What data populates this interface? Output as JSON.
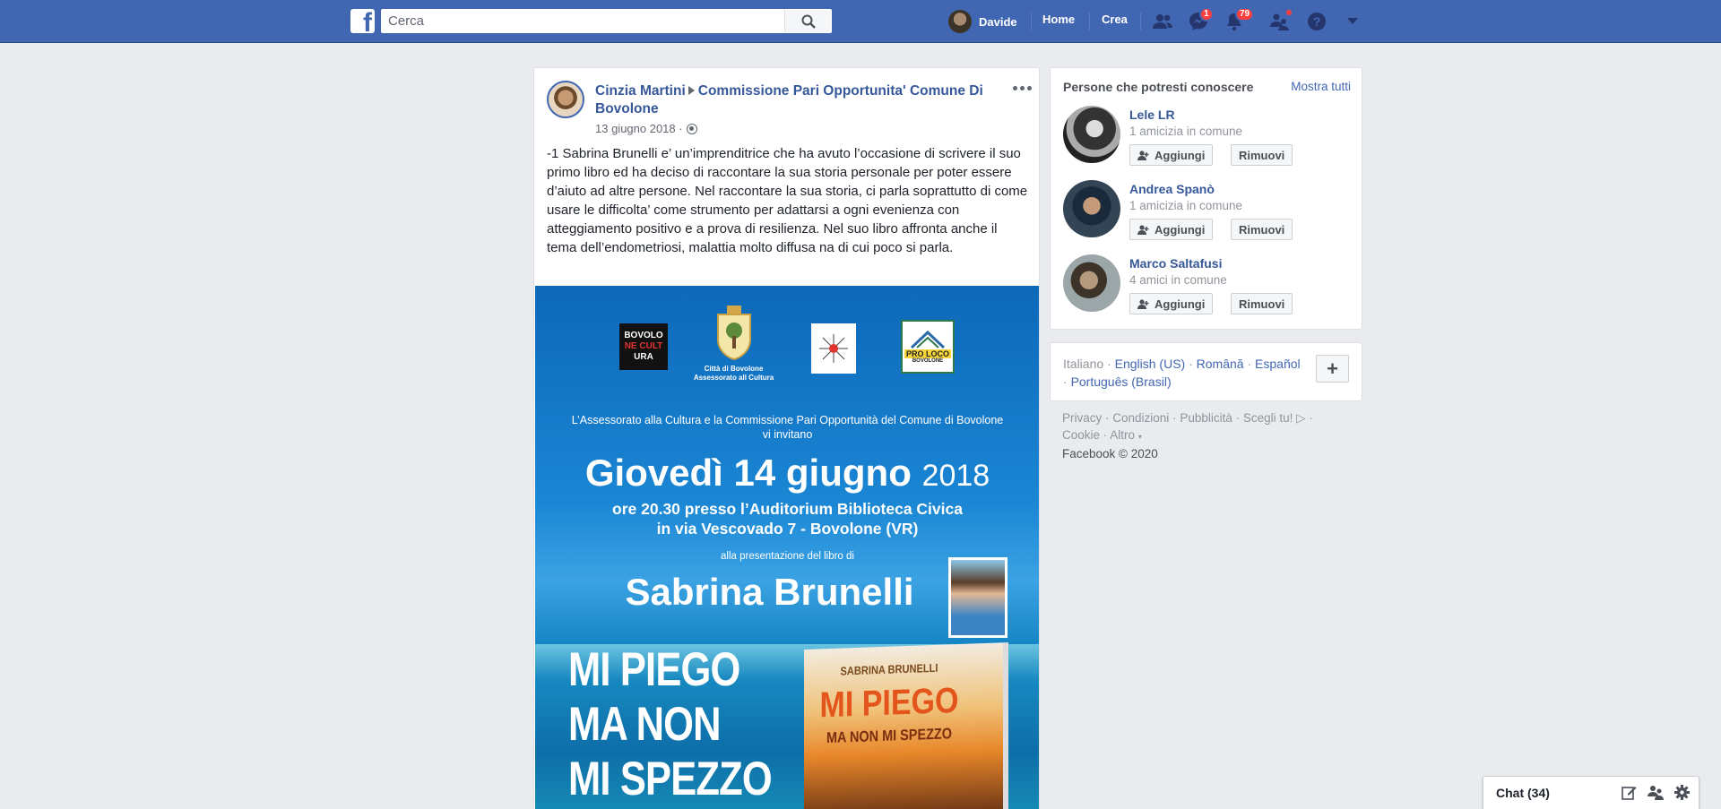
{
  "topbar": {
    "logo": "f",
    "search_placeholder": "Cerca",
    "user_name": "Davide",
    "home_label": "Home",
    "create_label": "Crea",
    "messenger_badge": "1",
    "notifications_badge": "79"
  },
  "post": {
    "author": "Cinzia Martini",
    "group": "Commissione Pari Opportunita' Comune Di Bovolone",
    "date": "13 giugno 2018 ·",
    "text": "-1 Sabrina Brunelli e’ un’imprenditrice che ha avuto l’occasione di scrivere il suo primo libro ed ha deciso di raccontare la sua storia personale per poter essere d’aiuto ad altre persone. Nel raccontare la sua storia, ci parla soprattutto di come usare le difficolta’ come strumento per adattarsi a ogni evenienza con atteggiamento positivo e a prova di resilienza. Nel suo libro affronta anche il tema dell’endometriosi, malattia molto diffusa na di cui poco si parla.",
    "poster": {
      "logo1_line1": "BOVOLO",
      "logo1_line2": "NE CULT",
      "logo1_line3": "URA",
      "logo2_caption1": "Città di Bovolone",
      "logo2_caption2": "Assessorato all Cultura",
      "logo4_text": "PRO LOCO",
      "logo4_sub": "BOVOLONE",
      "invite_line1": "L’Assessorato alla Cultura e la Commissione Pari Opportunità del Comune di Bovolone",
      "invite_line2": "vi invitano",
      "date_main": "Giovedì 14 giugno",
      "date_year": "2018",
      "venue_line1": "ore 20.30 presso l’Auditorium Biblioteca Civica",
      "venue_line2": "in via Vescovado 7 - Bovolone (VR)",
      "presentation": "alla presentazione del libro di",
      "author": "Sabrina Brunelli",
      "title_line1": "MI PIEGO",
      "title_line2": "MA NON",
      "title_line3": "MI SPEZZO",
      "book_author": "SABRINA BRUNELLI",
      "book_title": "MI PIEGO",
      "book_subtitle": "MA NON MI SPEZZO"
    }
  },
  "pymk": {
    "title": "Persone che potresti conoscere",
    "see_all": "Mostra tutti",
    "add_label": "Aggiungi",
    "remove_label": "Rimuovi",
    "people": [
      {
        "name": "Lele LR",
        "mutual": "1 amicizia in comune"
      },
      {
        "name": "Andrea Spanò",
        "mutual": "1 amicizia in comune"
      },
      {
        "name": "Marco Saltafusi",
        "mutual": "4 amici in comune"
      }
    ]
  },
  "languages": {
    "current": "Italiano",
    "others": [
      "English (US)",
      "Română",
      "Español",
      "Português (Brasil)"
    ]
  },
  "footer": {
    "links": [
      "Privacy",
      "Condizioni",
      "Pubblicità",
      "Scegli tu!",
      "Cookie",
      "Altro"
    ],
    "copyright": "Facebook © 2020"
  },
  "chat": {
    "label": "Chat (34)"
  },
  "colors": {
    "brand": "#4267b2",
    "link": "#365899",
    "badge": "#fa3e3e"
  }
}
